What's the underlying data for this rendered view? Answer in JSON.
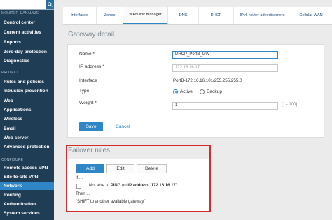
{
  "sidebar": {
    "search_placeholder": "",
    "sections": [
      {
        "head": "MONITOR & ANALYZE",
        "items": [
          "Control center",
          "Current activities",
          "Reports",
          "Zero-day protection",
          "Diagnostics"
        ]
      },
      {
        "head": "PROTECT",
        "items": [
          "Rules and policies",
          "Intrusion prevention",
          "Web",
          "Applications",
          "Wireless",
          "Email",
          "Web server",
          "Advanced protection"
        ]
      },
      {
        "head": "CONFIGURE",
        "items": [
          "Remote access VPN",
          "Site-to-site VPN",
          "Network",
          "Routing",
          "Authentication",
          "System services"
        ]
      }
    ],
    "active_item": "Network"
  },
  "tabs": [
    {
      "label": "Interfaces"
    },
    {
      "label": "Zones"
    },
    {
      "label": "WAN link manager",
      "active": true
    },
    {
      "label": "DNS"
    },
    {
      "label": "DHCP"
    },
    {
      "label": "IPv6 router advertisement"
    },
    {
      "label": "Cellular WAN"
    }
  ],
  "gateway_detail": {
    "title": "Gateway detail",
    "name_label": "Name *",
    "name_value": "DHCP_PortB_GW",
    "ip_label": "IP address *",
    "ip_placeholder": "172.16.16.17",
    "interface_label": "Interface",
    "interface_value": "PortB-172.16.16.101/255.255.255.0",
    "type_label": "Type",
    "type_options": [
      "Active",
      "Backup"
    ],
    "type_selected": "Active",
    "weight_label": "Weight *",
    "weight_value": "1",
    "weight_range": "[1 - 100]",
    "save_label": "Save",
    "cancel_label": "Cancel"
  },
  "failover": {
    "title": "Failover rules",
    "add_label": "Add",
    "edit_label": "Edit",
    "delete_label": "Delete",
    "if_text": "If ...",
    "rule_prefix": "Not able to",
    "rule_ping": "PING",
    "rule_middle": "on",
    "rule_ip": "IP address '172.16.16.17'",
    "then_text": "Then ...",
    "action_text": "\"SHIFT to another available gateway\""
  },
  "colors": {
    "sidebar_bg": "#1f3d55",
    "accent": "#2e86c7",
    "highlight_border": "#d62b2b"
  }
}
